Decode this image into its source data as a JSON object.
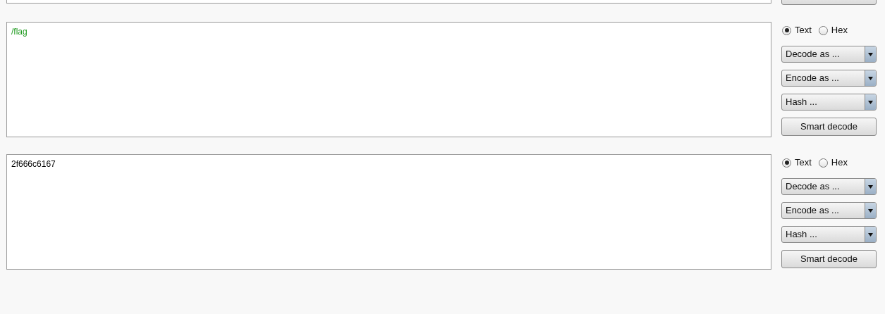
{
  "panels": [
    {
      "text": "/flag",
      "color": "#1f9a1f",
      "format_options": [
        {
          "label": "Text",
          "selected": true
        },
        {
          "label": "Hex",
          "selected": false
        }
      ],
      "menus": [
        "Decode as ...",
        "Encode as ...",
        "Hash ..."
      ],
      "smart_decode": "Smart decode"
    },
    {
      "text": "2f666c6167",
      "color": "#000000",
      "format_options": [
        {
          "label": "Text",
          "selected": true
        },
        {
          "label": "Hex",
          "selected": false
        }
      ],
      "menus": [
        "Decode as ...",
        "Encode as ...",
        "Hash ..."
      ],
      "smart_decode": "Smart decode"
    }
  ]
}
